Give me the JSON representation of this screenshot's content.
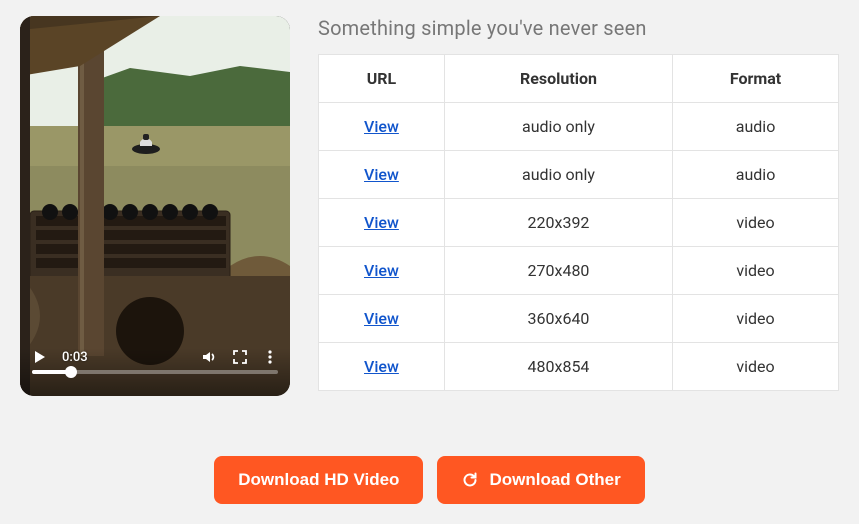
{
  "title": "Something simple you've never seen",
  "player": {
    "current_time": "0:03"
  },
  "table": {
    "headers": {
      "url": "URL",
      "resolution": "Resolution",
      "format": "Format"
    },
    "link_label": "View",
    "rows": [
      {
        "resolution": "audio only",
        "format": "audio"
      },
      {
        "resolution": "audio only",
        "format": "audio"
      },
      {
        "resolution": "220x392",
        "format": "video"
      },
      {
        "resolution": "270x480",
        "format": "video"
      },
      {
        "resolution": "360x640",
        "format": "video"
      },
      {
        "resolution": "480x854",
        "format": "video"
      }
    ]
  },
  "buttons": {
    "download_hd": "Download HD Video",
    "download_other": "Download Other"
  }
}
